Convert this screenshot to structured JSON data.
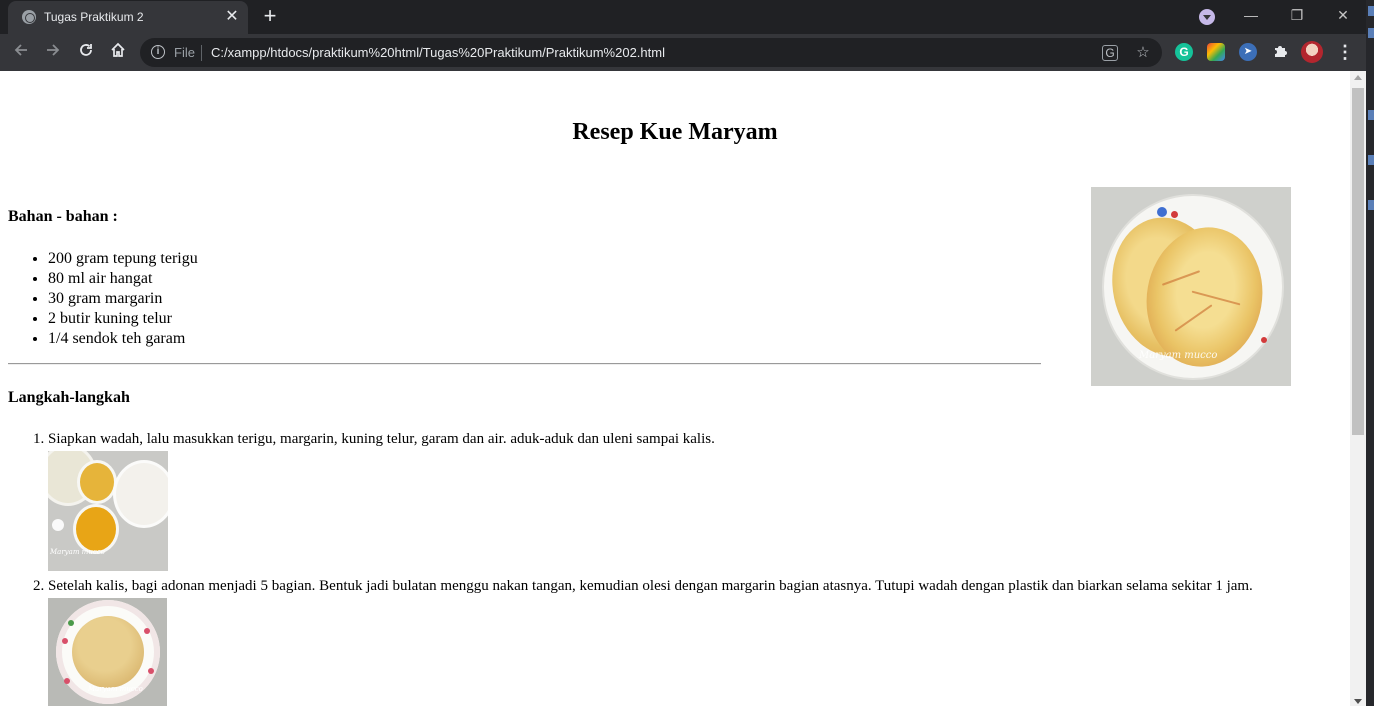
{
  "browser": {
    "tab_title": "Tugas Praktikum 2",
    "tab_close_glyph": "✕",
    "new_tab_glyph": "+",
    "scheme_label": "File",
    "url": "C:/xampp/htdocs/praktikum%20html/Tugas%20Praktikum/Praktikum%202.html",
    "window_min_glyph": "—",
    "window_max_glyph": "❐",
    "window_close_glyph": "✕",
    "icons": [
      "back-arrow-icon",
      "forward-arrow-icon",
      "reload-icon",
      "home-icon",
      "site-info-icon",
      "translate-icon",
      "bookmark-star-icon",
      "grammarly-extension-icon",
      "color-picker-extension-icon",
      "cursor-extension-icon",
      "extensions-puzzle-icon",
      "profile-avatar",
      "chrome-menu-icon"
    ]
  },
  "page": {
    "heading": "Resep Kue Maryam",
    "ingredients_title": "Bahan - bahan :",
    "ingredients": [
      "200 gram tepung terigu",
      "80 ml air hangat",
      "30 gram margarin",
      "2 butir kuning telur",
      "1/4 sendok teh garam"
    ],
    "steps_title": "Langkah-langkah",
    "steps": [
      "Siapkan wadah, lalu masukkan terigu, margarin, kuning telur, garam dan air. aduk-aduk dan uleni sampai kalis.",
      "Setelah kalis, bagi adonan menjadi 5 bagian. Bentuk jadi bulatan menggu nakan tangan, kemudian olesi dengan margarin bagian atasnya. Tutupi wadah dengan plastik dan biarkan selama sekitar 1 jam."
    ],
    "photo_watermark": "Maryam mucco",
    "step_photo_watermark": "Maryam mucco"
  },
  "colors": {
    "chrome_dark": "#202124",
    "chrome_toolbar": "#35363a",
    "page_background": "#ffffff",
    "scrollbar_thumb": "#c1c1c1"
  }
}
